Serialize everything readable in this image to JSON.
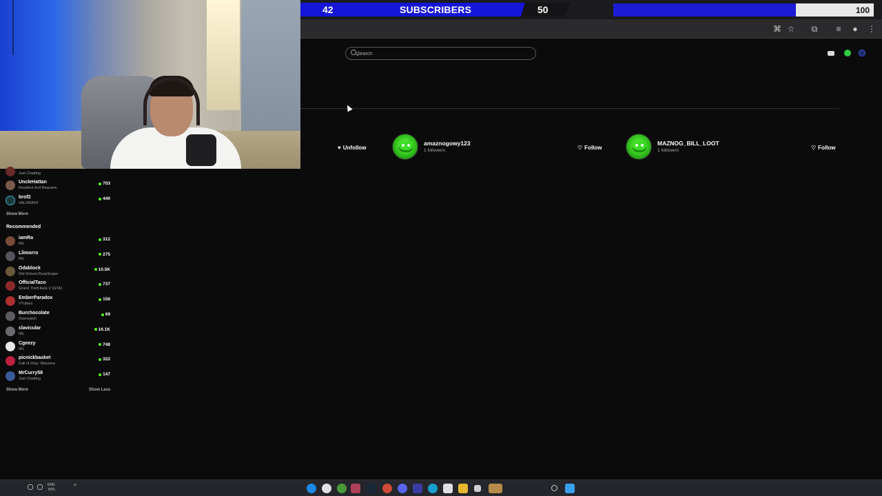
{
  "overlay": {
    "subs_current": "42",
    "subs_label": "SUBSCRIBERS",
    "subs_target": "50",
    "goal_fill_fraction": 0.7,
    "goal_max": "100"
  },
  "browser": {
    "icons": [
      "translate-icon",
      "star-icon",
      "extensions-icon",
      "media-icon",
      "profile-icon",
      "menu-icon"
    ]
  },
  "header": {
    "search_placeholder": "Search"
  },
  "following": [
    {
      "action": "Unfollow"
    },
    {
      "name": "amaznogowy123",
      "followers": "1 followers",
      "action": "Follow"
    },
    {
      "name": "MAZNOG_BILL_LOOT",
      "followers": "1 followers",
      "action": "Follow"
    }
  ],
  "sidebar": {
    "following_channels": [
      {
        "name": "",
        "game": "Just Chatting",
        "viewers": ""
      },
      {
        "name": "UncleHattan",
        "game": "Resident Evil Requiem",
        "viewers": "703"
      },
      {
        "name": "brof2",
        "game": "VALORANT",
        "viewers": "440"
      }
    ],
    "show_more_1": "Show More",
    "recommended_heading": "Recommended",
    "recommended": [
      {
        "name": "iamRa",
        "game": "IRL",
        "viewers": "312",
        "color": "#7a4a3a"
      },
      {
        "name": "Llimorro",
        "game": "IRL",
        "viewers": "275",
        "color": "#55555c"
      },
      {
        "name": "Odablock",
        "game": "Old School RuneScape",
        "viewers": "10.5K",
        "color": "#6a5a3a"
      },
      {
        "name": "OfficialTaco",
        "game": "Grand Theft Auto V (GTA)",
        "viewers": "737",
        "color": "#8a2a2a"
      },
      {
        "name": "EmberParadox",
        "game": "VTubers",
        "viewers": "156",
        "color": "#b03030"
      },
      {
        "name": "Burchocolate",
        "game": "Overwatch",
        "viewers": "69",
        "color": "#5a5a60"
      },
      {
        "name": "clavicular",
        "game": "IRL",
        "viewers": "16.1K",
        "color": "#6a6a70"
      },
      {
        "name": "Cgeezy",
        "game": "IRL",
        "viewers": "748",
        "color": "#e8e8e8"
      },
      {
        "name": "picnickbasket",
        "game": "Call of Duty: Warzone",
        "viewers": "322",
        "color": "#c02040"
      },
      {
        "name": "MrCurry58",
        "game": "Just Chatting",
        "viewers": "147",
        "color": "#3a5a9a"
      }
    ],
    "show_more_2": "Show More",
    "show_less": "Show Less"
  },
  "taskbar": {
    "lang": "ENG",
    "layout": "INTL"
  }
}
